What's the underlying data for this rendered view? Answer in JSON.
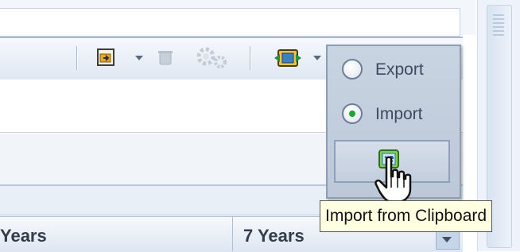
{
  "grid": {
    "columns": [
      {
        "label": "Years"
      },
      {
        "label": "7 Years"
      }
    ]
  },
  "popup": {
    "options": [
      {
        "label": "Export",
        "selected": false
      },
      {
        "label": "Import",
        "selected": true
      }
    ],
    "action_button_icon": "clipboard-import-icon"
  },
  "tooltip": {
    "text": "Import from Clipboard"
  },
  "toolbar": {
    "icons": [
      "import-document-icon",
      "delete-icon",
      "settings-icon",
      "import-export-icon"
    ]
  },
  "colors": {
    "radio_selected_dot": "#25a13a",
    "tooltip_bg": "#ffffe1",
    "popup_bg": "#c9d4e2"
  }
}
